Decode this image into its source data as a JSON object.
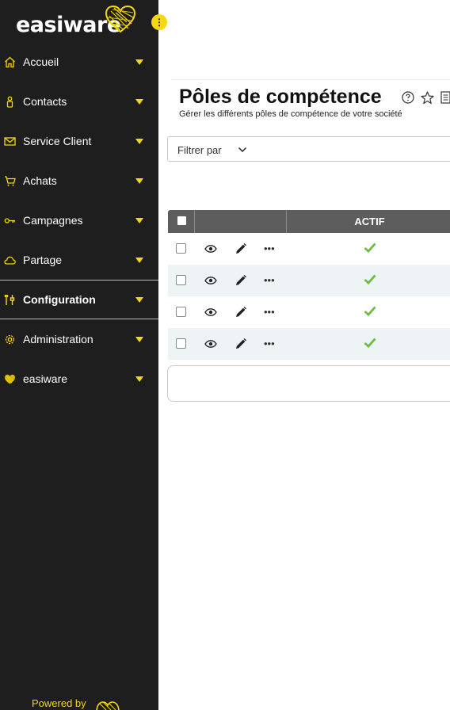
{
  "brand": {
    "name": "easiware",
    "accent_color": "#f5d80f",
    "sidebar_bg": "#1e1e1e",
    "footer_text": "Powered by"
  },
  "sidebar": {
    "items": [
      {
        "label": "Accueil",
        "icon": "home-icon"
      },
      {
        "label": "Contacts",
        "icon": "person-icon"
      },
      {
        "label": "Service Client",
        "icon": "mail-icon"
      },
      {
        "label": "Achats",
        "icon": "cart-icon"
      },
      {
        "label": "Campagnes",
        "icon": "key-icon"
      },
      {
        "label": "Partage",
        "icon": "cloud-icon"
      },
      {
        "label": "Configuration",
        "icon": "tools-icon",
        "active": true
      },
      {
        "label": "Administration",
        "icon": "gear-icon"
      },
      {
        "label": "easiware",
        "icon": "heart-icon"
      }
    ]
  },
  "page": {
    "title": "Pôles de compétence",
    "subtitle": "Gérer les différents pôles de compétence de votre société"
  },
  "filter": {
    "label": "Filtrer par"
  },
  "table": {
    "columns": [
      "ACTIF"
    ],
    "rows": [
      {
        "actif": true
      },
      {
        "actif": true
      },
      {
        "actif": true
      },
      {
        "actif": true
      }
    ],
    "status_color": "#6abf3f",
    "header_bg": "#5d5d5d",
    "alt_row_bg": "#eef3f6"
  }
}
